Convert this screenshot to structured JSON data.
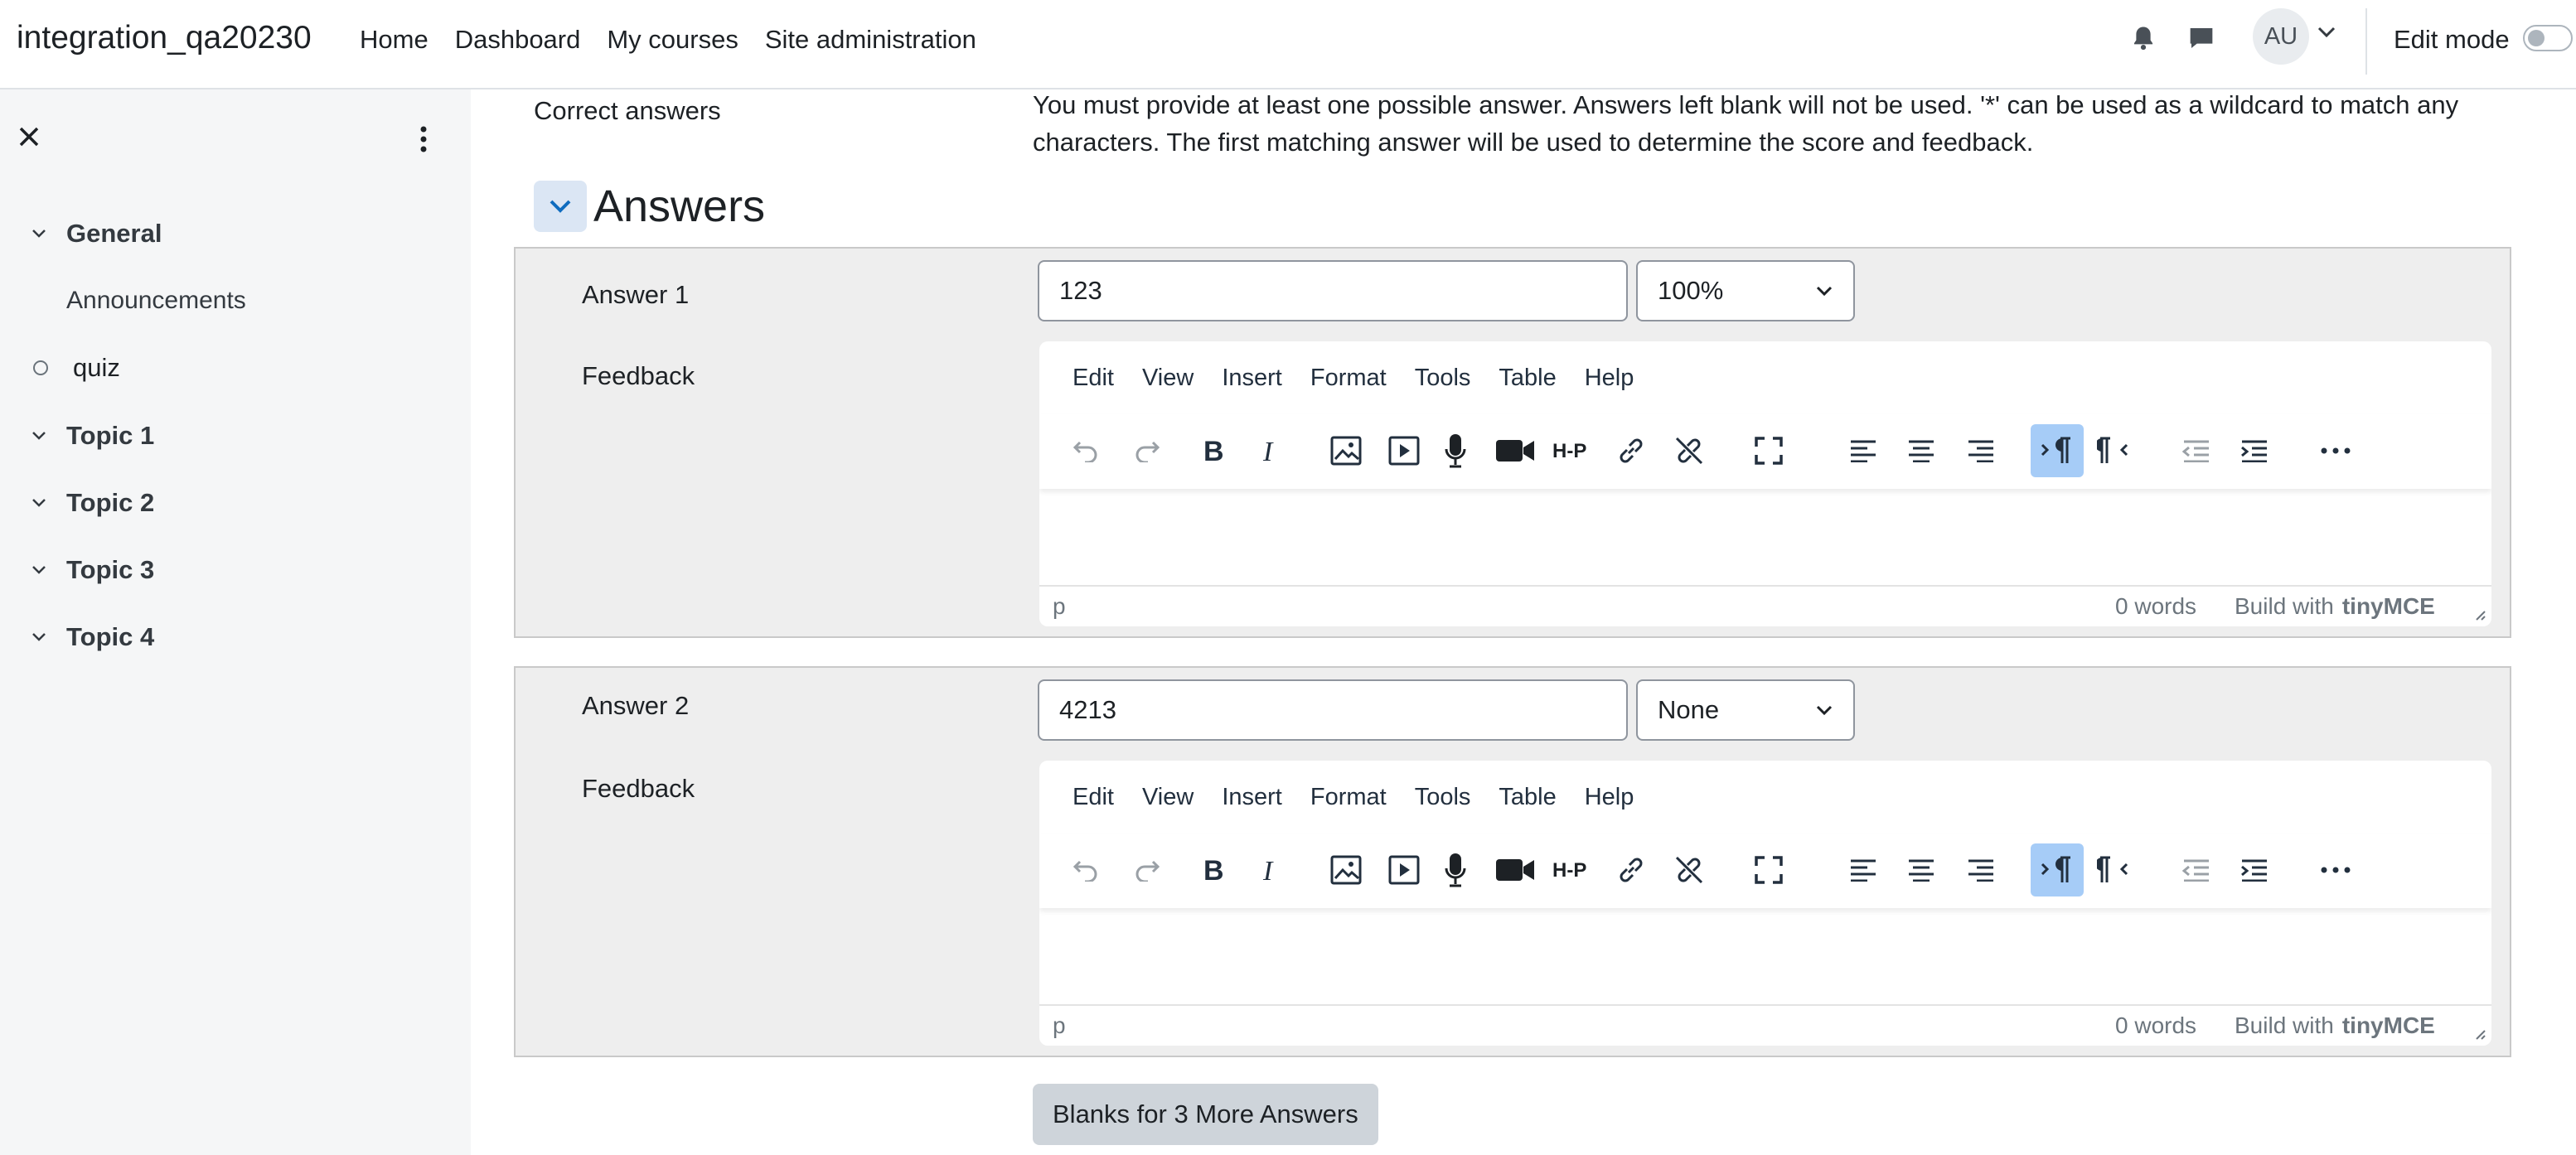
{
  "header": {
    "site_name": "integration_qa20230",
    "nav": [
      "Home",
      "Dashboard",
      "My courses",
      "Site administration"
    ],
    "avatar_initials": "AU",
    "edit_mode_label": "Edit mode"
  },
  "sidebar": {
    "items": [
      {
        "label": "General",
        "type": "section"
      },
      {
        "label": "Announcements",
        "type": "activity"
      },
      {
        "label": "quiz",
        "type": "activity"
      },
      {
        "label": "Topic 1",
        "type": "section"
      },
      {
        "label": "Topic 2",
        "type": "section"
      },
      {
        "label": "Topic 3",
        "type": "section"
      },
      {
        "label": "Topic 4",
        "type": "section"
      }
    ]
  },
  "form": {
    "correct_answers_label": "Correct answers",
    "correct_answers_help": "You must provide at least one possible answer. Answers left blank will not be used. '*' can be used as a wildcard to match any characters. The first matching answer will be used to determine the score and feedback.",
    "section_title": "Answers",
    "answers": [
      {
        "label": "Answer 1",
        "value": "123",
        "grade": "100%",
        "feedback_label": "Feedback"
      },
      {
        "label": "Answer 2",
        "value": "4213",
        "grade": "None",
        "feedback_label": "Feedback"
      }
    ],
    "more_answers_button": "Blanks for 3 More Answers"
  },
  "editor": {
    "menus": [
      "Edit",
      "View",
      "Insert",
      "Format",
      "Tools",
      "Table",
      "Help"
    ],
    "toolbar_icons": [
      "undo-icon",
      "redo-icon",
      "bold-icon",
      "italic-icon",
      "image-icon",
      "media-icon",
      "record-audio-icon",
      "record-video-icon",
      "h5p-icon",
      "link-icon",
      "unlink-icon",
      "fullscreen-icon",
      "align-left-icon",
      "align-center-icon",
      "align-right-icon",
      "ltr-icon",
      "rtl-icon",
      "outdent-icon",
      "indent-icon",
      "more-icon"
    ],
    "path": "p",
    "word_count": "0 words",
    "build_with": "Build with",
    "brand": "tinyMCE"
  },
  "colors": {
    "accent_active": "#a6ccf7",
    "sidebar_bg": "#f5f6f7",
    "fieldset_bg": "#eeeeee"
  }
}
